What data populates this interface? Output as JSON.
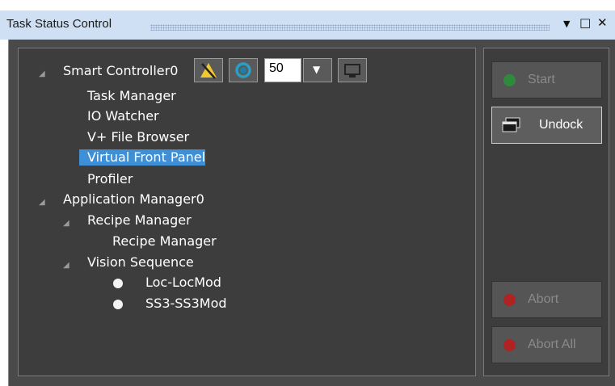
{
  "window": {
    "title": "Task Status Control",
    "dropdown_icon": "▼",
    "maximize_icon": "□",
    "close_icon": "✕"
  },
  "tree": {
    "controller": {
      "label": "Smart Controller0",
      "speed_value": "50",
      "children": [
        "Task Manager",
        "IO Watcher",
        "V+ File Browser",
        "Virtual Front Panel",
        "Profiler"
      ],
      "selected": "Virtual Front Panel"
    },
    "app_manager": {
      "label": "Application Manager0",
      "recipe_group": "Recipe Manager",
      "recipe_item": "Recipe Manager",
      "vision_group": "Vision Sequence",
      "vision_items": [
        "Loc-LocMod",
        "SS3-SS3Mod"
      ]
    }
  },
  "buttons": {
    "start": "Start",
    "undock": "Undock",
    "abort": "Abort",
    "abort_all": "Abort All"
  },
  "colors": {
    "start_dot": "#2e8b3e",
    "abort_dot": "#b02323",
    "selection": "#3f8fd6"
  }
}
